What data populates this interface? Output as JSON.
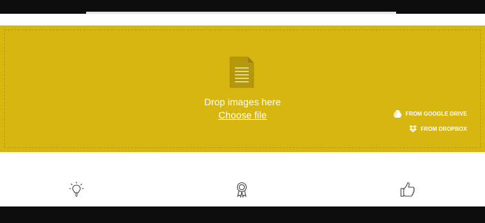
{
  "dropzone": {
    "drop_text": "Drop images here",
    "choose_file": "Choose file",
    "google_drive": "FROM GOOGLE DRIVE",
    "dropbox": "FROM DROPBOX"
  },
  "features": [
    {
      "icon": "lightbulb-icon"
    },
    {
      "icon": "award-ribbon-icon"
    },
    {
      "icon": "thumbs-up-icon"
    }
  ],
  "colors": {
    "dropzone_bg": "#d7b60f",
    "dropzone_border": "#b99d0c",
    "doc_icon": "#b5970b",
    "text": "#ffffff"
  }
}
